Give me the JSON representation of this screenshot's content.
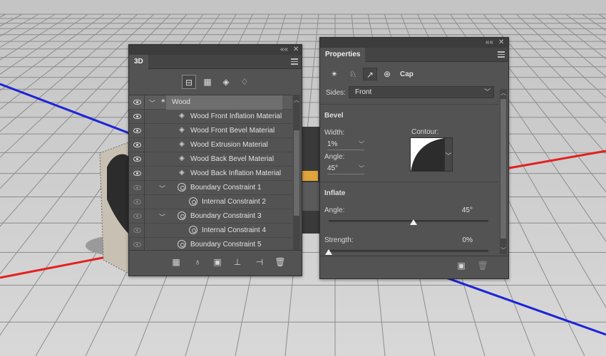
{
  "panel_3d": {
    "tab": "3D",
    "filter_buttons": [
      "scene-filter",
      "meshes-filter",
      "materials-filter",
      "lights-filter"
    ],
    "layers": [
      {
        "label": "Wood",
        "visible": true,
        "type": "mesh",
        "expanded": true
      },
      {
        "label": "Wood Front Inflation Material",
        "visible": true,
        "type": "material"
      },
      {
        "label": "Wood Front Bevel Material",
        "visible": true,
        "type": "material"
      },
      {
        "label": "Wood Extrusion Material",
        "visible": true,
        "type": "material"
      },
      {
        "label": "Wood Back Bevel Material",
        "visible": true,
        "type": "material"
      },
      {
        "label": "Wood Back Inflation Material",
        "visible": true,
        "type": "material"
      },
      {
        "label": "Boundary Constraint 1",
        "visible": false,
        "type": "constraint",
        "expanded": true
      },
      {
        "label": "Internal Constraint 2",
        "visible": false,
        "type": "constraint"
      },
      {
        "label": "Boundary Constraint 3",
        "visible": false,
        "type": "constraint",
        "expanded": true
      },
      {
        "label": "Internal Constraint 4",
        "visible": false,
        "type": "constraint"
      },
      {
        "label": "Boundary Constraint 5",
        "visible": false,
        "type": "constraint"
      }
    ],
    "bottom_icons": [
      "mesh-icon",
      "light-icon",
      "render-icon",
      "ground-icon",
      "constraint-icon",
      "trash-icon"
    ]
  },
  "properties": {
    "tab": "Properties",
    "mode_icons": [
      "mesh-icon",
      "deform-icon",
      "cap-icon",
      "coordinates-icon"
    ],
    "mode_label": "Cap",
    "sides_label": "Sides:",
    "sides_value": "Front",
    "bevel": {
      "title": "Bevel",
      "width_label": "Width:",
      "width_value": "1%",
      "angle_label": "Angle:",
      "angle_value": "45°",
      "contour_label": "Contour:"
    },
    "inflate": {
      "title": "Inflate",
      "angle_label": "Angle:",
      "angle_value": "45°",
      "angle_fraction": 0.53,
      "strength_label": "Strength:",
      "strength_value": "0%",
      "strength_fraction": 0.0
    }
  },
  "window_buttons": {
    "collapse": "««",
    "close": "✕"
  },
  "colors": {
    "axis_red": "#e41f1f",
    "axis_blue": "#1c24d8",
    "panel": "#535353",
    "grid": "#9e9e9e"
  }
}
